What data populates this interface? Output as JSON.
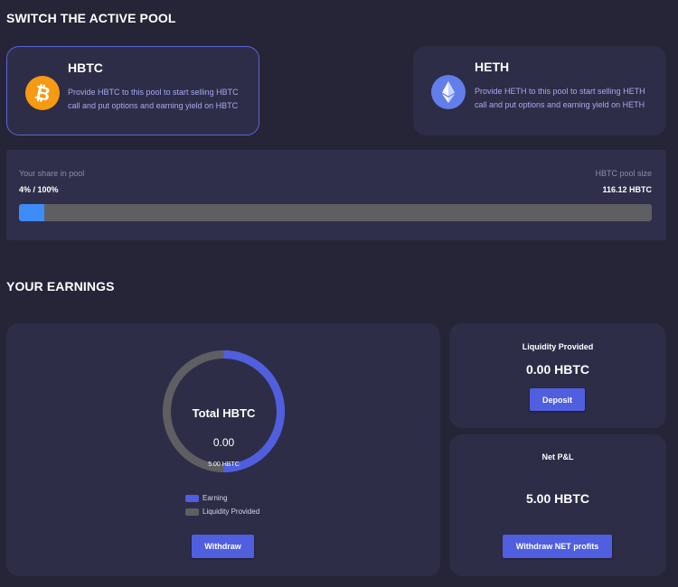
{
  "switch_title": "SWITCH THE ACTIVE POOL",
  "pools": [
    {
      "name": "HBTC",
      "description": "Provide HBTC to this pool to start selling HBTC call and put options and earning yield on HBTC",
      "icon": "bitcoin-icon",
      "active": true
    },
    {
      "name": "HETH",
      "description": "Provide HETH to this pool to start selling HETH call and put options and earning yield on HETH",
      "icon": "ethereum-icon",
      "active": false
    }
  ],
  "share": {
    "label": "Your share in pool",
    "value": "4% / 100%",
    "pool_size_label": "HBTC pool size",
    "pool_size_value": "116.12 HBTC",
    "progress": 0.04
  },
  "earnings_title": "YOUR EARNINGS",
  "total": {
    "title": "Total HBTC",
    "value": "0.00",
    "sub": "5.00 HBTC",
    "earning_fraction": 0.5
  },
  "legend": [
    {
      "label": "Earning",
      "color": "#4f5fe0"
    },
    {
      "label": "Liquidity Provided",
      "color": "#5f5f63"
    }
  ],
  "withdraw_label": "Withdraw",
  "liquidity": {
    "title": "Liquidity Provided",
    "value": "0.00 HBTC",
    "button": "Deposit"
  },
  "pnl": {
    "title": "Net P&L",
    "value": "5.00 HBTC",
    "button": "Withdraw NET profits"
  },
  "colors": {
    "background": "#262537",
    "card": "#2e2d47",
    "accent": "#4f5fe0",
    "progress": "#3d8cf7",
    "bitcoin": "#f59a12",
    "ethereum": "#627eea"
  }
}
